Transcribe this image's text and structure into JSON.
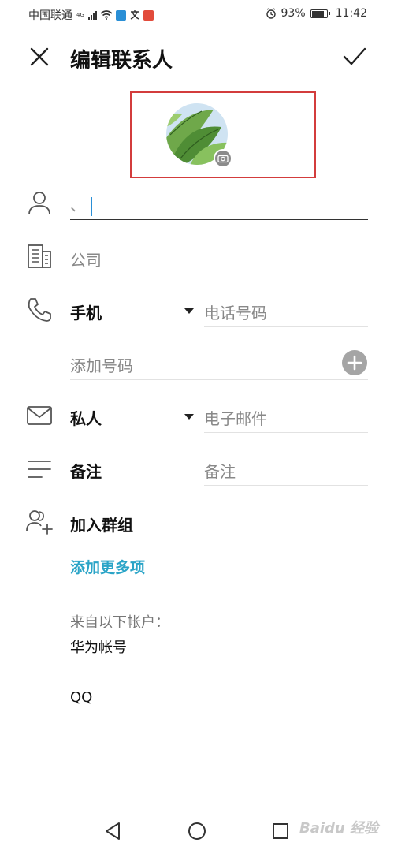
{
  "status_bar": {
    "carrier": "中国联通",
    "network": "4G",
    "battery_percent": "93%",
    "battery_level": 0.93,
    "time": "11:42",
    "icons": [
      "signal-icon",
      "wifi-icon",
      "app-badge-icon",
      "translate-icon",
      "app-notification-icon",
      "alarm-icon",
      "battery-icon"
    ]
  },
  "header": {
    "title": "编辑联系人",
    "close_icon": "close-icon",
    "confirm_icon": "check-icon"
  },
  "avatar": {
    "camera_icon": "camera-icon"
  },
  "name_field": {
    "value": "、  ",
    "icon": "person-icon"
  },
  "company_field": {
    "placeholder": "公司",
    "icon": "company-icon"
  },
  "phone": {
    "type_label": "手机",
    "placeholder": "电话号码",
    "add_label": "添加号码",
    "icon": "phone-icon"
  },
  "email": {
    "type_label": "私人",
    "placeholder": "电子邮件",
    "icon": "mail-icon"
  },
  "note": {
    "label": "备注",
    "placeholder": "备注",
    "icon": "note-icon"
  },
  "group": {
    "label": "加入群组",
    "icon": "add-group-icon"
  },
  "add_more_label": "添加更多项",
  "accounts": {
    "section_label": "来自以下帐户：",
    "items": [
      "华为帐号",
      "QQ"
    ]
  },
  "nav_bar": {
    "icons": [
      "back-icon",
      "home-icon",
      "recents-icon"
    ]
  },
  "watermark": "Baidu 经验",
  "colors": {
    "accent": "#2aa4c7",
    "highlight_border": "#d33c3c",
    "add_button": "#a5a5a5"
  }
}
